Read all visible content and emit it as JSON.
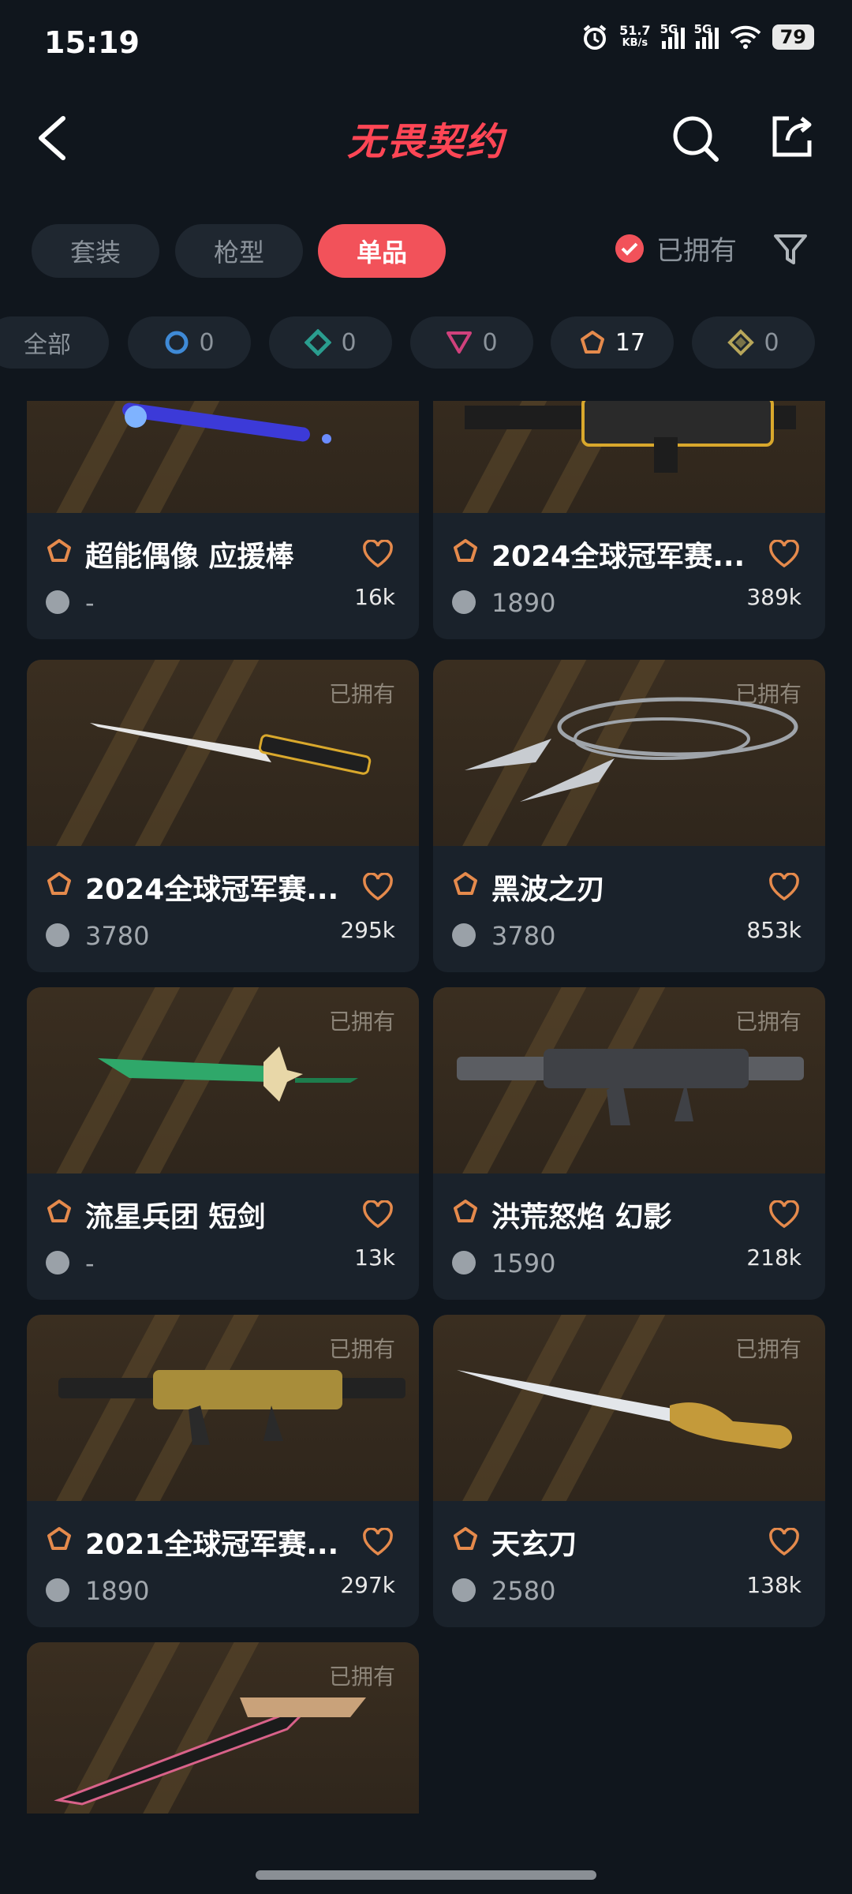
{
  "status": {
    "time": "15:19",
    "net_speed_value": "51.7",
    "net_speed_unit": "KB/s",
    "sig1": "5G",
    "sig2": "5G",
    "battery": "79"
  },
  "header": {
    "title": "无畏契约"
  },
  "tabs": [
    {
      "label": "套装",
      "active": false
    },
    {
      "label": "枪型",
      "active": false
    },
    {
      "label": "单品",
      "active": true
    }
  ],
  "owned_filter": {
    "label": "已拥有",
    "checked": true
  },
  "tiers": [
    {
      "label": "全部"
    },
    {
      "count": "0",
      "color": "#3f8ad6"
    },
    {
      "count": "0",
      "color": "#2a9d8f"
    },
    {
      "count": "0",
      "color": "#d0417c"
    },
    {
      "count": "17",
      "color": "#e58a4c"
    },
    {
      "count": "0",
      "color": "#b7a65a"
    }
  ],
  "items": [
    {
      "name": "超能偶像 应援棒",
      "price": "-",
      "likes": "16k",
      "owned": ""
    },
    {
      "name": "2024全球冠军赛...",
      "price": "1890",
      "likes": "389k",
      "owned": ""
    },
    {
      "name": "2024全球冠军赛...",
      "price": "3780",
      "likes": "295k",
      "owned": "已拥有"
    },
    {
      "name": "黑波之刃",
      "price": "3780",
      "likes": "853k",
      "owned": "已拥有"
    },
    {
      "name": "流星兵团 短剑",
      "price": "-",
      "likes": "13k",
      "owned": "已拥有"
    },
    {
      "name": "洪荒怒焰 幻影",
      "price": "1590",
      "likes": "218k",
      "owned": "已拥有"
    },
    {
      "name": "2021全球冠军赛...",
      "price": "1890",
      "likes": "297k",
      "owned": "已拥有"
    },
    {
      "name": "天玄刀",
      "price": "2580",
      "likes": "138k",
      "owned": "已拥有"
    },
    {
      "name": "",
      "price": "",
      "likes": "",
      "owned": "已拥有"
    }
  ],
  "colors": {
    "accent": "#f2525a",
    "tier": "#e58a4c",
    "background": "#10161d"
  }
}
